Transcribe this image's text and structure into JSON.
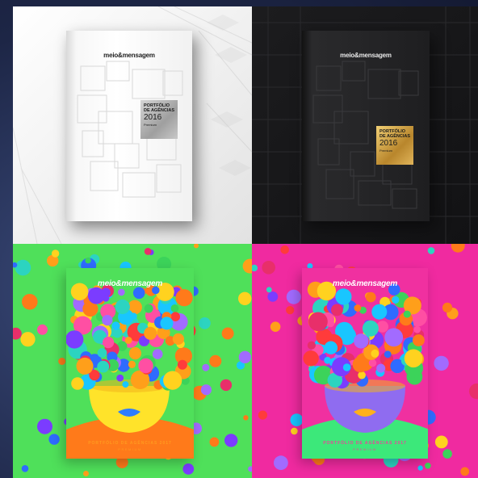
{
  "covers": [
    {
      "id": "white-2016",
      "brand": "meio&mensagem",
      "label_line1": "PORTFÓLIO",
      "label_line2": "DE AGÊNCIAS",
      "label_year": "2016",
      "label_note": "Premium",
      "colors": {
        "background": "#ffffff",
        "book": "#f5f5f5",
        "label": "#b8b8b8"
      }
    },
    {
      "id": "black-2016",
      "brand": "meio&mensagem",
      "label_line1": "PORTFÓLIO",
      "label_line2": "DE AGÊNCIAS",
      "label_year": "2016",
      "label_note": "Premium",
      "colors": {
        "background": "#141416",
        "book": "#242426",
        "label": "#c89a3e"
      }
    },
    {
      "id": "green-2017",
      "brand": "meio&mensagem",
      "footer_title": "PORTFÓLIO DE AGÊNCIAS 2017",
      "footer_sub": "PREMIUM",
      "colors": {
        "background": "#4fe05a",
        "book": "#4fe05a",
        "face": "#ffe32a",
        "accent": "#ff9a1f"
      }
    },
    {
      "id": "pink-2017",
      "brand": "meio&mensagem",
      "footer_title": "PORTFÓLIO DE AGÊNCIAS 2017",
      "footer_sub": "PREMIUM",
      "colors": {
        "background": "#f02aa0",
        "book": "#3ce87a",
        "face": "#8f6cf0",
        "accent": "#f0409a"
      }
    }
  ]
}
